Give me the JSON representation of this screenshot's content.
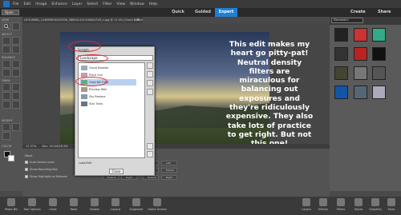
{
  "menubar": {
    "items": [
      "File",
      "Edit",
      "Image",
      "Enhance",
      "Layer",
      "Select",
      "Filter",
      "View",
      "Window",
      "Help"
    ]
  },
  "modebar": {
    "open_label": "Open",
    "tabs": [
      "Quick",
      "Guided",
      "Expert"
    ],
    "create_label": "Create",
    "share_label": "Share"
  },
  "toolbox": {
    "groups": [
      "VIEW",
      "SELECT",
      "ENHANCE",
      "DRAW",
      "MODIFY",
      "COLOR"
    ]
  },
  "document": {
    "tab_title": "LIF41668D_144669616419356_386041151416644726_n.jpg @ 17.4% (Cloud Booster, RGB/8)",
    "close_glyph": "×",
    "overlay_text": "This edit makes my heart go pitty-pat! Neutral density filters are miraculous for balancing out exposures and they're ridiculously expensive. They also take lots of practice to get right. But not this one!"
  },
  "scripts_dialog": {
    "title": "Scripts",
    "category": "Landscape",
    "items": [
      "Cloud Booster",
      "Place Sun",
      "Grad ND Filter",
      "Preview Wall",
      "Sky Restore",
      "Star Trails"
    ],
    "selected_index": 2,
    "load_label": "Load/Edit",
    "close_label": "Close"
  },
  "right_panel": {
    "select_label": "Elements+"
  },
  "status": {
    "zoom": "17.37%",
    "doc_info": "Doc: 20.2M/20.2M"
  },
  "tool_options": {
    "move_label": "Move",
    "auto_select": "Auto Select Layer",
    "show_bounding": "Show Bounding Box",
    "show_highlight": "Show Highlight on Rollover",
    "arrange_label": "Arrange",
    "align_labels": [
      "Top",
      "Center",
      "Bottom",
      "Left",
      "Middle",
      "Right"
    ]
  },
  "bottom_bar": {
    "left_items": [
      "Photo Bin",
      "Tool Options",
      "Undo",
      "Redo",
      "Rotate",
      "Layout",
      "Organizer",
      "Home Screen"
    ],
    "right_items": [
      "Layers",
      "Effects",
      "Filters",
      "Styles",
      "Graphics",
      "More"
    ]
  }
}
